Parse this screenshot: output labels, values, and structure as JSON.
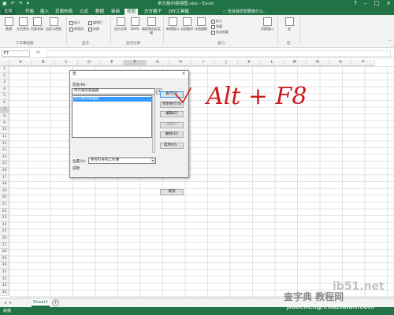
{
  "app": {
    "window_title": "单元格内容插图.xlsx - Excel",
    "qat_icons": [
      "save-icon",
      "undo-icon",
      "redo-icon",
      "customize-icon"
    ]
  },
  "ribbon": {
    "tabs": [
      {
        "label": "文件",
        "key": "file"
      },
      {
        "label": "开始",
        "key": "home"
      },
      {
        "label": "插入",
        "key": "insert"
      },
      {
        "label": "页面布局",
        "key": "layout"
      },
      {
        "label": "公式",
        "key": "formulas"
      },
      {
        "label": "数据",
        "key": "data"
      },
      {
        "label": "审阅",
        "key": "review"
      },
      {
        "label": "视图",
        "key": "view",
        "active": true
      },
      {
        "label": "方方格子",
        "key": "ffcell"
      },
      {
        "label": "DIY工具箱",
        "key": "diy"
      }
    ],
    "tell_me": "告诉我您想要做什么...",
    "view_buttons": {
      "normal": "普通",
      "page_break": "分页预览",
      "page_layout": "页面布局",
      "custom_views": "自定义视图",
      "zoom": "显示比例",
      "zoom100": "100%",
      "zoom_selection": "缩放到选定区域",
      "new_window": "新建窗口",
      "arrange_all": "全部重排",
      "freeze": "冻结窗格",
      "switch_windows": "切换窗口",
      "macros": "宏"
    },
    "show_checks": [
      "标尺",
      "网格线",
      "编辑栏",
      "标题"
    ],
    "window_checks": [
      "拆分",
      "隐藏",
      "取消隐藏"
    ],
    "groups": {
      "workbook_views": "工作簿视图",
      "show": "显示",
      "zoom": "显示比例",
      "window": "窗口",
      "macros": "宏"
    }
  },
  "formula_bar": {
    "name_box": "F7",
    "fx": "fx",
    "value": ""
  },
  "grid": {
    "columns": [
      "A",
      "B",
      "C",
      "D",
      "E",
      "F",
      "G",
      "H",
      "I",
      "J",
      "K",
      "L",
      "M",
      "N",
      "O",
      "P"
    ],
    "selected_column": "F",
    "selected_row": "7",
    "rows": [
      "1",
      "2",
      "3",
      "4",
      "5",
      "6",
      "7",
      "8",
      "9",
      "10",
      "11",
      "12",
      "13",
      "14",
      "15",
      "16",
      "17",
      "18",
      "19",
      "20",
      "21",
      "22",
      "23",
      "24",
      "25",
      "26",
      "27",
      "28",
      "29",
      "30",
      "31",
      "32",
      "33",
      "34"
    ]
  },
  "dialog": {
    "title": "宏",
    "close": "×",
    "macro_name_label": "宏名(M):",
    "macro_name_value": "单元格内容插图",
    "macro_list": [
      "单元格内容插图"
    ],
    "buttons": {
      "run": "执行(R)",
      "step_into": "单步执行(S)",
      "edit": "编辑(E)",
      "create": "创建(C)",
      "delete": "删除(D)",
      "options": "选项(O)...",
      "cancel": "取消"
    },
    "macros_in_label": "位置(A):",
    "macros_in_value": "所有打开的工作簿",
    "description_label": "说明"
  },
  "annotation": {
    "handwriting": "Alt + F8"
  },
  "sheets": {
    "tabs": [
      "Sheet1"
    ],
    "nav_icons": [
      "prev-sheet-icon",
      "next-sheet-icon"
    ],
    "add_icon": "+"
  },
  "status_bar": {
    "mode": "就绪"
  },
  "watermark": {
    "site": "ib51.net",
    "brand": "查字典 教程网",
    "url": "jiaocheng.chazidian.com"
  },
  "colors": {
    "excel_green": "#217346",
    "selection_blue": "#3399ff",
    "ink_red": "#cc1b1b"
  }
}
